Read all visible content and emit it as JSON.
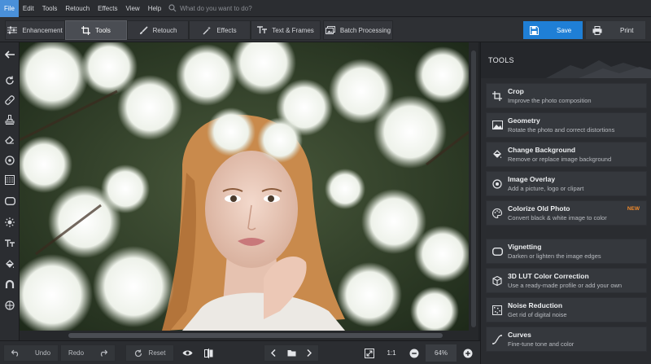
{
  "menu": {
    "items": [
      "File",
      "Edit",
      "Tools",
      "Retouch",
      "Effects",
      "View",
      "Help"
    ],
    "search_placeholder": "What do you want to do?"
  },
  "toolbar": {
    "tabs": [
      "Enhancement",
      "Tools",
      "Retouch",
      "Effects",
      "Text & Frames",
      "Batch Processing"
    ],
    "active_tab": "Tools",
    "save_label": "Save",
    "print_label": "Print"
  },
  "panel": {
    "title": "TOOLS",
    "cards": [
      {
        "title": "Crop",
        "subtitle": "Improve the photo composition",
        "icon": "crop-icon",
        "badge": ""
      },
      {
        "title": "Geometry",
        "subtitle": "Rotate the photo and correct distortions",
        "icon": "geometry-icon",
        "badge": ""
      },
      {
        "title": "Change Background",
        "subtitle": "Remove or replace image background",
        "icon": "paint-bucket-icon",
        "badge": ""
      },
      {
        "title": "Image Overlay",
        "subtitle": "Add a picture, logo or clipart",
        "icon": "overlay-icon",
        "badge": ""
      },
      {
        "title": "Colorize Old Photo",
        "subtitle": "Convert black & white image to color",
        "icon": "palette-icon",
        "badge": "NEW"
      },
      {
        "title": "Vignetting",
        "subtitle": "Darken or lighten the image edges",
        "icon": "vignette-icon",
        "badge": ""
      },
      {
        "title": "3D LUT Color Correction",
        "subtitle": "Use a ready-made profile or add your own",
        "icon": "cube-icon",
        "badge": ""
      },
      {
        "title": "Noise Reduction",
        "subtitle": "Get rid of digital noise",
        "icon": "noise-icon",
        "badge": ""
      },
      {
        "title": "Curves",
        "subtitle": "Fine-tune tone and color",
        "icon": "curves-icon",
        "badge": ""
      }
    ]
  },
  "bottombar": {
    "undo_label": "Undo",
    "redo_label": "Redo",
    "reset_label": "Reset",
    "actual_size_label": "1:1",
    "zoom_value": "64%"
  },
  "colors": {
    "accent": "#1f7fd6",
    "badge": "#f08a2c",
    "panel_bg": "#2a2c30"
  }
}
